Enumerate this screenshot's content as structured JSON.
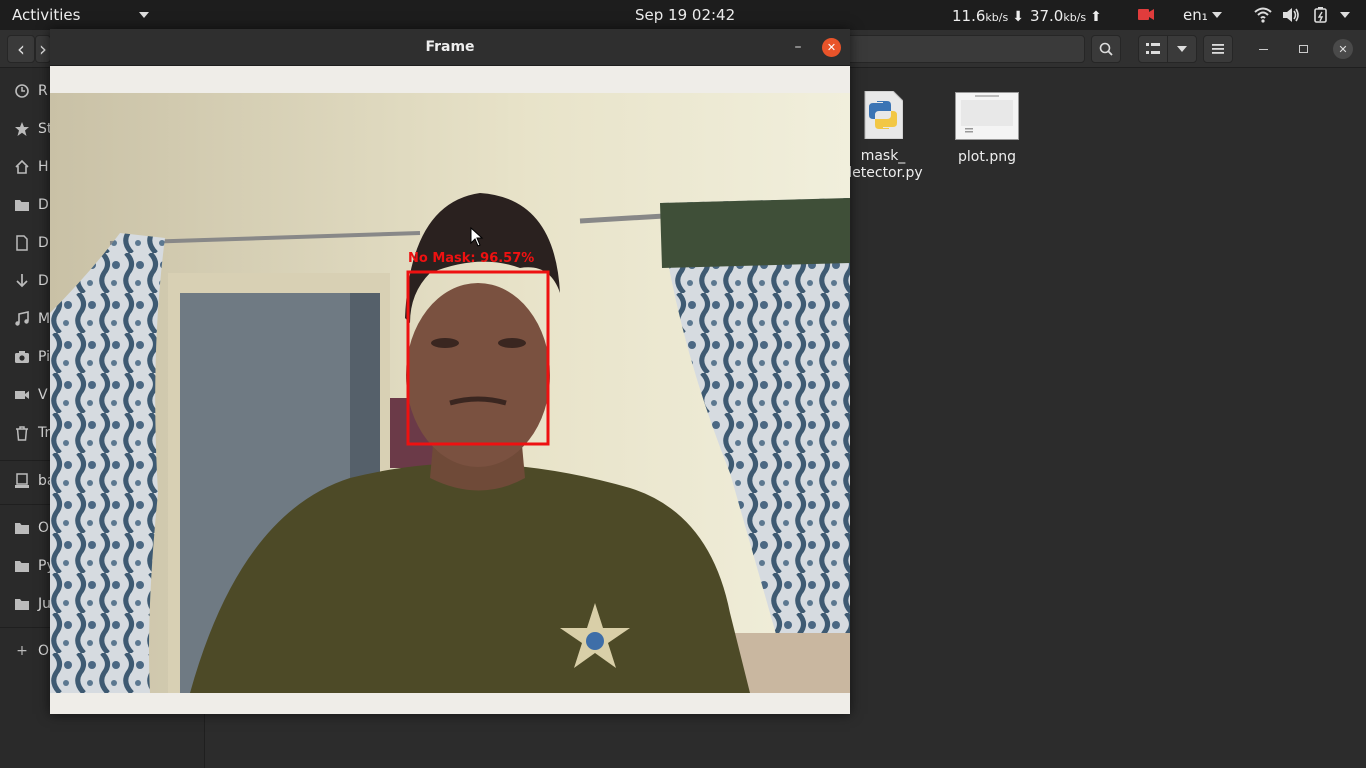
{
  "topbar": {
    "activities": "Activities",
    "clock": "Sep 19  02:42",
    "net_down_value": "11.6",
    "net_down_unit": "kb/s",
    "net_up_value": "37.0",
    "net_up_unit": "kb/s",
    "down_arrow": "⬇",
    "up_arrow": "⬆",
    "language": "en₁",
    "icons": [
      "video-record-icon",
      "wifi-icon",
      "volume-icon",
      "battery-icon"
    ]
  },
  "file_manager": {
    "back_icon": "‹",
    "forward_icon": "›",
    "sidebar": {
      "items": [
        {
          "label": "R",
          "icon": "clock-icon"
        },
        {
          "label": "St",
          "icon": "star-icon"
        },
        {
          "label": "H",
          "icon": "home-icon"
        },
        {
          "label": "D",
          "icon": "folder-icon"
        },
        {
          "label": "D",
          "icon": "document-icon"
        },
        {
          "label": "D",
          "icon": "download-icon"
        },
        {
          "label": "M",
          "icon": "music-icon"
        },
        {
          "label": "Pi",
          "icon": "camera-icon"
        },
        {
          "label": "V",
          "icon": "video-icon"
        },
        {
          "label": "Tr",
          "icon": "trash-icon"
        },
        {
          "label": "ba",
          "icon": "drive-icon"
        },
        {
          "label": "O",
          "icon": "folder-icon"
        },
        {
          "label": "Py",
          "icon": "folder-icon"
        },
        {
          "label": "Ju",
          "icon": "folder-icon"
        },
        {
          "label": "O",
          "icon": "plus-icon"
        }
      ]
    },
    "files": [
      {
        "name_line1": "mask_",
        "name_line2": "detector.py",
        "icon": "python-file-icon"
      },
      {
        "name_line1": "plot.png",
        "name_line2": "",
        "icon": "image-thumbnail-icon"
      }
    ]
  },
  "frame_window": {
    "title": "Frame",
    "minimize": "–",
    "close": "✕",
    "detection_label": "No Mask: 96.57%",
    "colors": {
      "detection": "#ee1111",
      "close_button": "#e9542a"
    }
  }
}
